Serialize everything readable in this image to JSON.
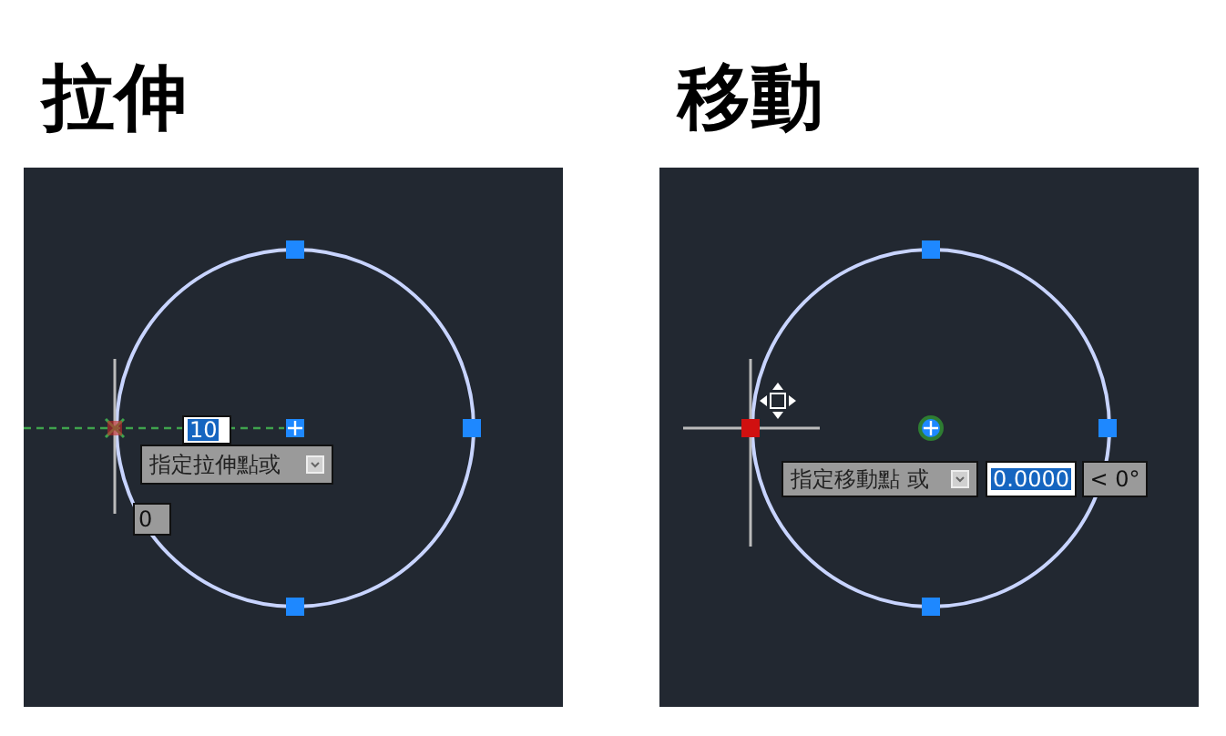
{
  "panels": [
    {
      "kind": "stretch",
      "title": "拉伸",
      "prompt": "指定拉伸點或",
      "inputs": [
        {
          "value": "10",
          "selected": true
        },
        {
          "value": "0",
          "selected": false
        }
      ]
    },
    {
      "kind": "move",
      "title": "移動",
      "prompt": "指定移動點 或",
      "inputs": [
        {
          "value": "0.0000",
          "selected": true
        },
        {
          "value": "< 0°",
          "selected": false
        }
      ]
    }
  ]
}
